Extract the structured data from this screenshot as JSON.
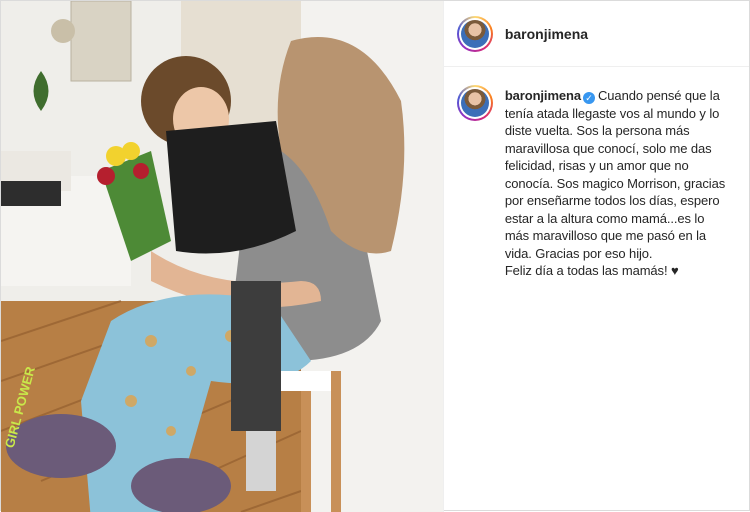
{
  "post": {
    "username": "baronjimena",
    "caption": {
      "first_line_rest": "Cuando pensé que la",
      "lines": [
        "tenía atada llegaste vos al mundo y lo",
        "diste vuelta. Sos la persona más",
        "maravillosa que conocí, solo me das",
        "felicidad, risas y un amor que no",
        "conocía. Sos magico Morrison, gracias",
        "por enseñarme todos los días, espero",
        "estar a la altura como mamá...es lo",
        "más maravilloso que me pasó en la",
        "vida. Gracias por eso hijo.",
        "Feliz día a todas las mamás! ♥"
      ]
    },
    "photo": {
      "slipper_text": "GIRL POWER"
    }
  },
  "icons": {
    "verified": "verified-badge-icon"
  },
  "colors": {
    "verified": "#3897f0",
    "text": "#262626"
  }
}
